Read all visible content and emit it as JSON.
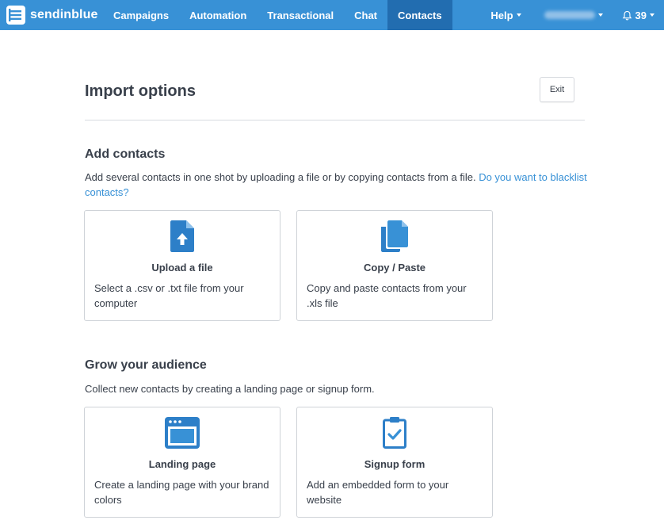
{
  "header": {
    "brand": "sendinblue",
    "nav": [
      "Campaigns",
      "Automation",
      "Transactional",
      "Chat",
      "Contacts"
    ],
    "active": "Contacts",
    "help_label": "Help",
    "notifications_count": "39",
    "accent_color": "#3891d6",
    "active_color": "#226db0"
  },
  "page": {
    "title": "Import options",
    "exit_label": "Exit"
  },
  "add_contacts": {
    "title": "Add contacts",
    "description": "Add several contacts in one shot by uploading a file or by copying contacts from a file.",
    "link": "Do you want to blacklist contacts?",
    "cards": [
      {
        "icon": "file-upload-icon",
        "title": "Upload a file",
        "description": "Select a .csv or .txt file from your computer"
      },
      {
        "icon": "copy-paste-icon",
        "title": "Copy / Paste",
        "description": "Copy and paste contacts from your .xls file"
      }
    ]
  },
  "grow_audience": {
    "title": "Grow your audience",
    "description": "Collect new contacts by creating a landing page or signup form.",
    "cards": [
      {
        "icon": "landing-page-icon",
        "title": "Landing page",
        "description": "Create a landing page with your brand colors"
      },
      {
        "icon": "signup-form-icon",
        "title": "Signup form",
        "description": "Add an embedded form to your website"
      }
    ]
  }
}
